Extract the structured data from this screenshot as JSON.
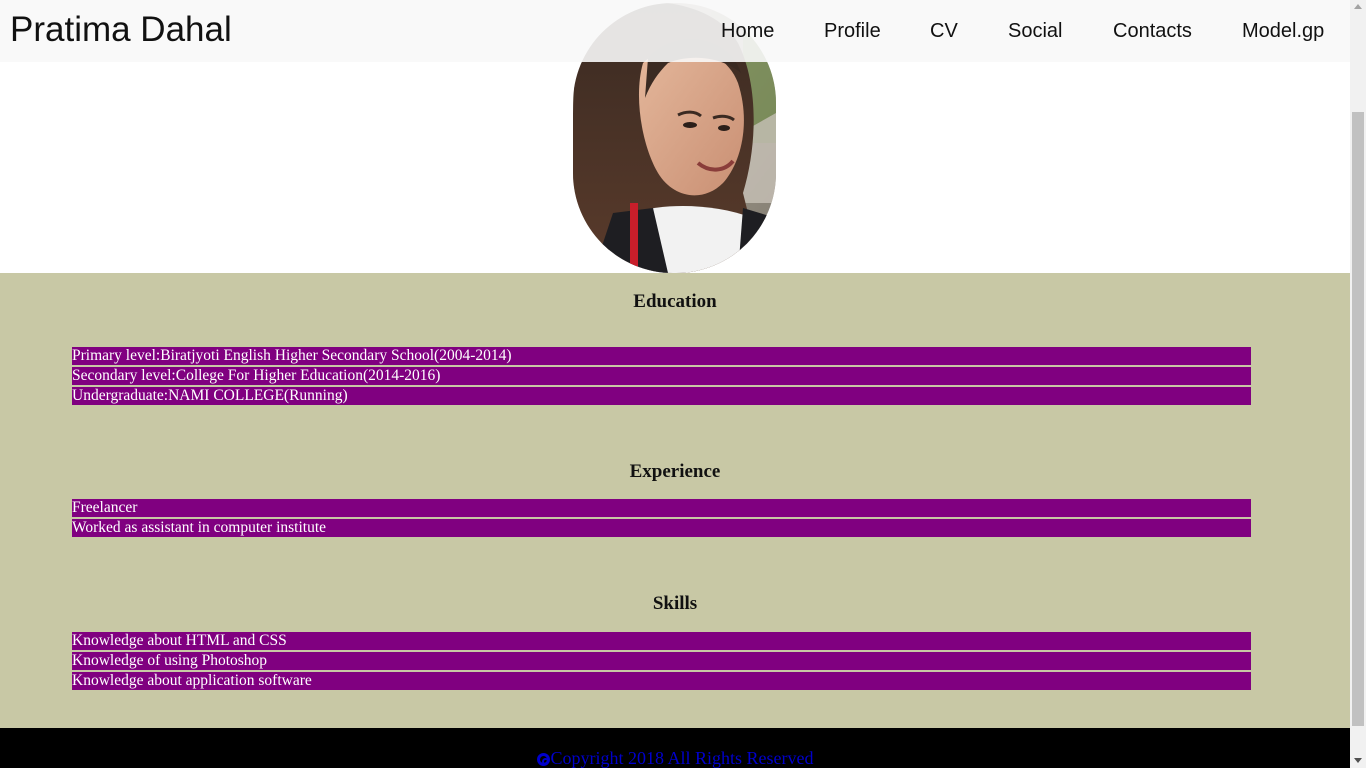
{
  "header": {
    "brand": "Pratima Dahal",
    "nav": [
      "Home",
      "Profile",
      "CV",
      "Social",
      "Contacts",
      "Model.gp"
    ]
  },
  "sections": {
    "education": {
      "title": "Education",
      "items": [
        "Primary level:Biratjyoti English Higher Secondary School(2004-2014)",
        "Secondary level:College For Higher Education(2014-2016)",
        "Undergraduate:NAMI COLLEGE(Running)"
      ]
    },
    "experience": {
      "title": "Experience",
      "items": [
        "Freelancer",
        "Worked as assistant in computer institute"
      ]
    },
    "skills": {
      "title": "Skills",
      "items": [
        "Knowledge about HTML and CSS",
        "Knowledge of using Photoshop",
        "Knowledge about application software"
      ]
    }
  },
  "footer": {
    "copyright": "Copyright 2018 All Rights Reserved"
  },
  "colors": {
    "content_background": "#c8c8a5",
    "bar_background": "#800080",
    "footer_background": "#000000",
    "footer_text": "#0000cc"
  }
}
